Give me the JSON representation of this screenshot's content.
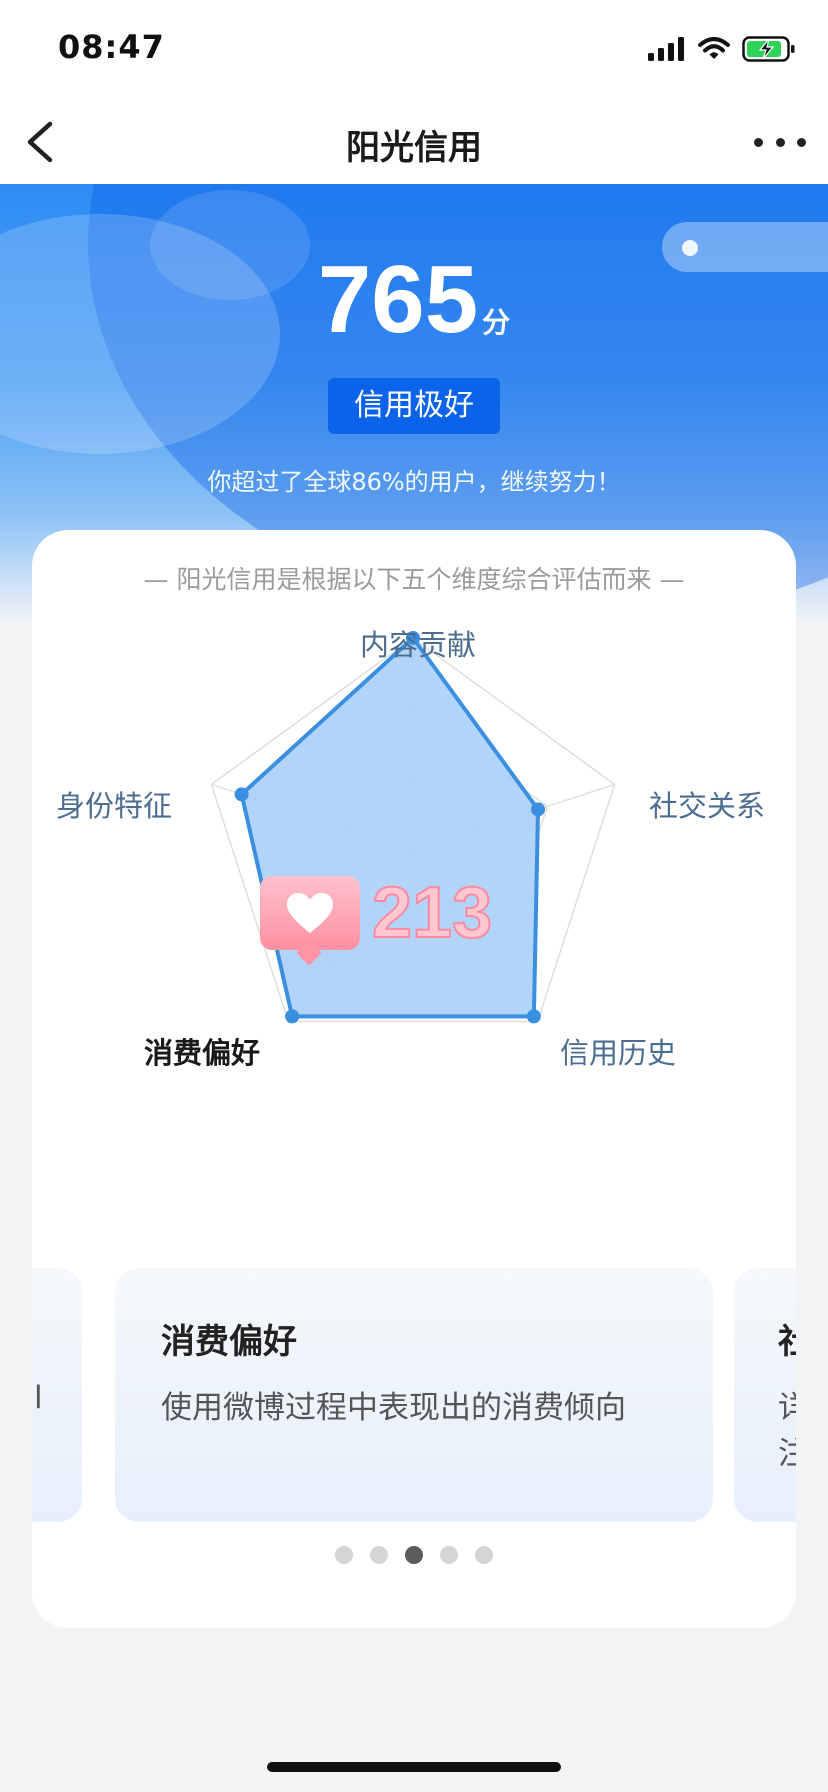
{
  "status_bar": {
    "time": "08:47"
  },
  "nav": {
    "title": "阳光信用"
  },
  "hero": {
    "score": "765",
    "score_unit": "分",
    "level": "信用极好",
    "description": "你超过了全球86%的用户，继续努力！"
  },
  "card": {
    "subtitle": "— 阳光信用是根据以下五个维度综合评估而来 —",
    "dimensions": [
      {
        "label": "内容贡献",
        "value": 1.0
      },
      {
        "label": "社交关系",
        "value": 0.62
      },
      {
        "label": "信用历史",
        "value": 0.97
      },
      {
        "label": "消费偏好",
        "value": 0.97
      },
      {
        "label": "身份特征",
        "value": 0.85
      }
    ],
    "active_dimension": "消费偏好",
    "like_count": "213",
    "carousel": {
      "current": {
        "title": "消费偏好",
        "description": "使用微博过程中表现出的消费倾向"
      },
      "next_fragment": {
        "title": "社",
        "desc_line1": "详",
        "desc_line2": "注"
      },
      "prev_fragment": {
        "desc": "l"
      },
      "page_count": 5,
      "active_index": 2
    }
  },
  "colors": {
    "accent": "#0a63e8",
    "radar_fill": "#a8cff7",
    "radar_stroke": "#3a8fe0",
    "label_color": "#4d6d90"
  },
  "icons": [
    "back-chevron-icon",
    "more-dots-icon",
    "signal-icon",
    "wifi-icon",
    "battery-charging-icon",
    "heart-icon"
  ]
}
